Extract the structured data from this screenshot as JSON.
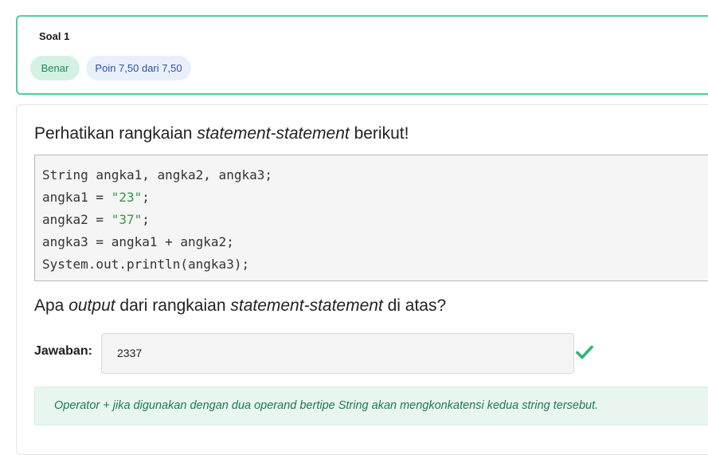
{
  "header": {
    "question_label": "Soal 1",
    "status_badge": "Benar",
    "points_badge": "Poin 7,50 dari 7,50"
  },
  "question": {
    "prompt_prefix": "Perhatikan rangkaian ",
    "prompt_emph": "statement-statement",
    "prompt_suffix": " berikut!",
    "code_lines": [
      {
        "pre": "String angka1, angka2, angka3;",
        "str": "",
        "post": ""
      },
      {
        "pre": "angka1 = ",
        "str": "\"23\"",
        "post": ";"
      },
      {
        "pre": "angka2 = ",
        "str": "\"37\"",
        "post": ";"
      },
      {
        "pre": "angka3 = angka1 + angka2;",
        "str": "",
        "post": ""
      },
      {
        "pre": "System.out.println(angka3);",
        "str": "",
        "post": ""
      }
    ],
    "ask_prefix": "Apa ",
    "ask_emph1": "output",
    "ask_mid": " dari rangkaian ",
    "ask_emph2": "statement-statement",
    "ask_suffix": " di atas?"
  },
  "answer": {
    "label": "Jawaban:",
    "value": "2337",
    "status_icon": "check-icon"
  },
  "feedback": {
    "text": "Operator + jika digunakan dengan dua operand bertipe String akan mengkonkatensi kedua string tersebut."
  },
  "colors": {
    "accent_green": "#4fcf98",
    "check_green": "#2bb673",
    "string_green": "#2f9a4a"
  }
}
